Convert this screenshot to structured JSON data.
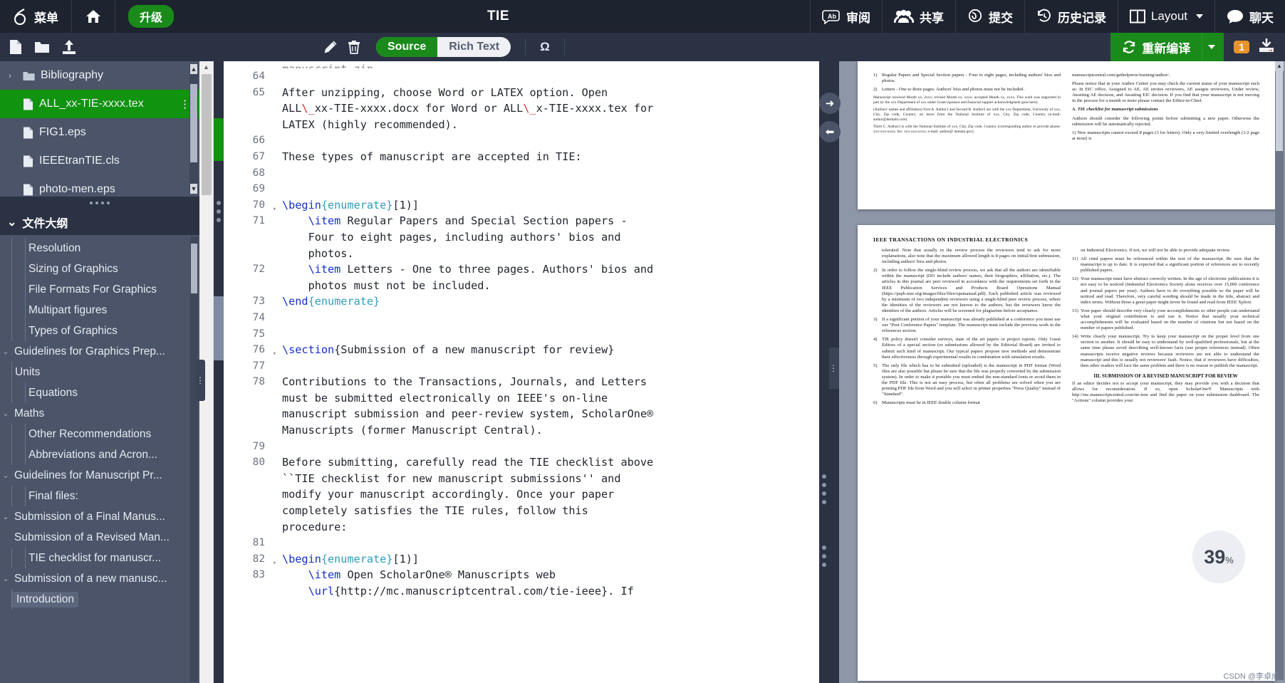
{
  "topbar": {
    "menu_label": "菜单",
    "home_icon": "home-icon",
    "upgrade_label": "升级",
    "project_title": "TIE",
    "review_label": "审阅",
    "share_label": "共享",
    "submit_label": "提交",
    "history_label": "历史记录",
    "layout_label": "Layout",
    "chat_label": "聊天"
  },
  "toolbar2": {
    "new_file_icon": "new-file-icon",
    "new_folder_icon": "new-folder-icon",
    "upload_icon": "upload-icon",
    "rename_icon": "pencil-icon",
    "delete_icon": "trash-icon",
    "source_label": "Source",
    "richtext_label": "Rich Text",
    "symbol_label": "Ω",
    "recompile_label": "重新编译",
    "warning_count": "1",
    "download_icon": "download-icon"
  },
  "sidebar": {
    "files": [
      {
        "label": "Bibliography",
        "type": "folder",
        "selected": false
      },
      {
        "label": "ALL_xx-TIE-xxxx.tex",
        "type": "file",
        "selected": true
      },
      {
        "label": "FIG1.eps",
        "type": "file",
        "selected": false
      },
      {
        "label": "IEEEtranTIE.cls",
        "type": "file",
        "selected": false
      },
      {
        "label": "photo-men.eps",
        "type": "file",
        "selected": false
      }
    ],
    "outline_header": "文件大纲",
    "outline": [
      {
        "label": "Introduction",
        "level": 1,
        "caret": "",
        "active": true
      },
      {
        "label": "Submission of a new manusc...",
        "level": 0,
        "caret": "v",
        "active": false
      },
      {
        "label": "TIE checklist for manuscr...",
        "level": 2,
        "caret": "",
        "active": false
      },
      {
        "label": "Submission of a Revised Man...",
        "level": 0,
        "caret": "",
        "active": false
      },
      {
        "label": "Submission of a Final Manus...",
        "level": 0,
        "caret": "v",
        "active": false
      },
      {
        "label": "Final files:",
        "level": 2,
        "caret": "",
        "active": false
      },
      {
        "label": "Guidelines for Manuscript Pr...",
        "level": 0,
        "caret": "v",
        "active": false
      },
      {
        "label": "Abbreviations and Acron...",
        "level": 2,
        "caret": "",
        "active": false
      },
      {
        "label": "Other Recommendations",
        "level": 2,
        "caret": "",
        "active": false
      },
      {
        "label": "Maths",
        "level": 0,
        "caret": "v",
        "active": false
      },
      {
        "label": "Equations",
        "level": 2,
        "caret": "",
        "active": false
      },
      {
        "label": "Units",
        "level": 1,
        "caret": "",
        "active": false
      },
      {
        "label": "Guidelines for Graphics Prep...",
        "level": 0,
        "caret": "v",
        "active": false
      },
      {
        "label": "Types of Graphics",
        "level": 2,
        "caret": "",
        "active": false
      },
      {
        "label": "Multipart figures",
        "level": 2,
        "caret": "",
        "active": false
      },
      {
        "label": "File Formats For Graphics",
        "level": 2,
        "caret": "",
        "active": false
      },
      {
        "label": "Sizing of Graphics",
        "level": 2,
        "caret": "",
        "active": false
      },
      {
        "label": "Resolution",
        "level": 2,
        "caret": "",
        "active": false
      }
    ]
  },
  "editor": {
    "top_partial_line": "manuscript.zip.",
    "lines": [
      {
        "n": "64",
        "fold": false,
        "segments": []
      },
      {
        "n": "65",
        "fold": false,
        "segments": [
          {
            "t": "After unzipping, choose Word or LATEX option. Open",
            "c": ""
          }
        ]
      },
      {
        "n": "",
        "fold": false,
        "segments": [
          {
            "t": "ALL",
            "c": ""
          },
          {
            "t": "\\_",
            "c": "bs"
          },
          {
            "t": "xx-TIE-xxxx.docx for Word or ALL",
            "c": ""
          },
          {
            "t": "\\_",
            "c": "bs"
          },
          {
            "t": "x-TIE-xxxx.tex for",
            "c": ""
          }
        ]
      },
      {
        "n": "",
        "fold": false,
        "segments": [
          {
            "t": "LATEX (highly recommended).",
            "c": ""
          }
        ]
      },
      {
        "n": "66",
        "fold": false,
        "segments": []
      },
      {
        "n": "67",
        "fold": false,
        "segments": [
          {
            "t": "These types of manuscript are accepted in TIE:",
            "c": ""
          }
        ]
      },
      {
        "n": "68",
        "fold": false,
        "segments": []
      },
      {
        "n": "69",
        "fold": false,
        "segments": []
      },
      {
        "n": "70",
        "fold": true,
        "segments": [
          {
            "t": "\\begin",
            "c": "kw"
          },
          {
            "t": "{enumerate}",
            "c": "env"
          },
          {
            "t": "[1)]",
            "c": ""
          }
        ]
      },
      {
        "n": "71",
        "fold": false,
        "segments": [
          {
            "t": "    ",
            "c": ""
          },
          {
            "t": "\\item",
            "c": "kw"
          },
          {
            "t": " Regular Papers and Special Section papers -",
            "c": ""
          }
        ]
      },
      {
        "n": "",
        "fold": false,
        "segments": [
          {
            "t": "    Four to eight pages, including authors' bios and",
            "c": ""
          }
        ]
      },
      {
        "n": "",
        "fold": false,
        "segments": [
          {
            "t": "    photos.",
            "c": ""
          }
        ]
      },
      {
        "n": "72",
        "fold": false,
        "segments": [
          {
            "t": "    ",
            "c": ""
          },
          {
            "t": "\\item",
            "c": "kw"
          },
          {
            "t": " Letters - One to three pages. Authors' bios and",
            "c": ""
          }
        ]
      },
      {
        "n": "",
        "fold": false,
        "segments": [
          {
            "t": "    photos must not be included.",
            "c": ""
          }
        ]
      },
      {
        "n": "73",
        "fold": false,
        "segments": [
          {
            "t": "\\end",
            "c": "kw"
          },
          {
            "t": "{enumerate}",
            "c": "env"
          }
        ]
      },
      {
        "n": "74",
        "fold": false,
        "segments": []
      },
      {
        "n": "75",
        "fold": false,
        "segments": []
      },
      {
        "n": "76",
        "fold": true,
        "segments": [
          {
            "t": "\\section",
            "c": "kw"
          },
          {
            "t": "{Submission of a new manuscript for review}",
            "c": ""
          }
        ]
      },
      {
        "n": "77",
        "fold": false,
        "segments": []
      },
      {
        "n": "78",
        "fold": false,
        "segments": [
          {
            "t": "Contributions to the Transactions, Journals, and Letters",
            "c": ""
          }
        ]
      },
      {
        "n": "",
        "fold": false,
        "segments": [
          {
            "t": "must be submitted electronically on IEEE's on-line",
            "c": ""
          }
        ]
      },
      {
        "n": "",
        "fold": false,
        "segments": [
          {
            "t": "manuscript submission and peer-review system, ScholarOne®",
            "c": ""
          }
        ]
      },
      {
        "n": "",
        "fold": false,
        "segments": [
          {
            "t": "Manuscripts (former Manuscript Central).",
            "c": ""
          }
        ]
      },
      {
        "n": "79",
        "fold": false,
        "segments": []
      },
      {
        "n": "80",
        "fold": false,
        "segments": [
          {
            "t": "Before submitting, carefully read the TIE checklist above",
            "c": ""
          }
        ]
      },
      {
        "n": "",
        "fold": false,
        "segments": [
          {
            "t": "``TIE checklist for new manuscript submissions'' and",
            "c": ""
          }
        ]
      },
      {
        "n": "",
        "fold": false,
        "segments": [
          {
            "t": "modify your manuscript accordingly. Once your paper",
            "c": ""
          }
        ]
      },
      {
        "n": "",
        "fold": false,
        "segments": [
          {
            "t": "completely satisfies the TIE rules, follow this",
            "c": ""
          }
        ]
      },
      {
        "n": "",
        "fold": false,
        "segments": [
          {
            "t": "procedure:",
            "c": ""
          }
        ]
      },
      {
        "n": "81",
        "fold": false,
        "segments": []
      },
      {
        "n": "82",
        "fold": true,
        "segments": [
          {
            "t": "\\begin",
            "c": "kw"
          },
          {
            "t": "{enumerate}",
            "c": "env"
          },
          {
            "t": "[1)]",
            "c": ""
          }
        ]
      },
      {
        "n": "83",
        "fold": false,
        "segments": [
          {
            "t": "    ",
            "c": ""
          },
          {
            "t": "\\item",
            "c": "kw"
          },
          {
            "t": " Open ScholarOne® Manuscripts web",
            "c": ""
          }
        ]
      },
      {
        "n": "",
        "fold": false,
        "segments": [
          {
            "t": "    ",
            "c": ""
          },
          {
            "t": "\\url",
            "c": "kw"
          },
          {
            "t": "{http://mc.manuscriptcentral.com/tie-ieee}",
            "c": ""
          },
          {
            "t": ". If",
            "c": ""
          }
        ]
      }
    ]
  },
  "pdf": {
    "zoom_level": "39",
    "zoom_unit": "%",
    "page1": {
      "col_left": [
        {
          "num": "1)",
          "text": "Regular Papers and Special Section papers - Four to eight pages, including authors' bios and photos."
        },
        {
          "num": "2)",
          "text": "Letters - One to three pages. Authors' bios and photos must not be included."
        }
      ],
      "meta_line": "Manuscript received Month xx, 2xxx; revised Month xx, xxxx; accepted Month xx, xxxx. This work was supported in part by the xxx Department of xxx under Grant (sponsor and financial support acknowledgment goes here).",
      "author_note_1": "(Authors' names and affiliation) First A. Author1 and Second B. Author2 are with the xxx Department, University of xxx, City, Zip code, Country, on leave from the National Institute of xxx, City, Zip code, Country (e-mail: author@domain.com).",
      "author_note_2": "Third C. Author3 is with the National Institute of xxx, City, Zip code, Country (corresponding author to provide phone: xxx-xxx-xxxx; fax: xxx-xxx-xxxx; e-mail: author@ domain.gov).",
      "col_right_top": "manuscriptcentral.com/gethelpnow/training/author/.",
      "col_right_p1": "Please notice that in your Author Center you may check the current status of your manuscript such as: In EIC office, Assigned to AE, AE invites reviewers, AE assigns reviewers, Under review, Awaiting AE decision, and Awaiting EIC decision. If you find that your manuscript is not moving in the process for a month or more please contact the Editor-in-Chief.",
      "checklist_title": "A. TIE checklist for manuscript submissions",
      "checklist_intro": "Authors should consider the following points before submitting a new paper. Otherwise the submission will be automatically rejected.",
      "checklist_item1": "1) New manuscripts cannot exceed 8 pages (3 for letters). Only a very limited overlength (1/2 page at most) is"
    },
    "page2": {
      "header": "IEEE TRANSACTIONS ON INDUSTRIAL ELECTRONICS",
      "left_items": [
        {
          "num": "",
          "text": "tolerated. Note that usually in the review process the reviewers tend to ask for more explanations, also note that the maximum allowed length is 8 pages on initial/first submission, including authors' bios and photos."
        },
        {
          "num": "2)",
          "text": "In order to follow the single-blind review process, we ask that all the authors are identifiable within the manuscript (DO include authors' names, their biographies, affiliation, etc.). The articles in this journal are peer reviewed in accordance with the requirements set forth in the IEEE Publication Services and Products Board Operations Manual (https://pspb.ieee.org/images/files/files/opsmanual.pdf). Each published article was reviewed by a minimum of two independent reviewers using a single-blind peer review process, where the identities of the reviewers are not known to the authors, but the reviewers know the identities of the authors. Articles will be screened for plagiarism before acceptance."
        },
        {
          "num": "3)",
          "text": "If a significant portion of your manuscript was already published at a conference you must use our \"Post Conference Papers\" template. The manuscript must include the previous work in the references section."
        },
        {
          "num": "4)",
          "text": "TIE policy doesn't consider surveys, state of the art papers or project reports. Only Guest Editors of a special section (or submissions allowed by the Editorial Board) are invited to submit such kind of manuscript. Our typical papers propose new methods and demonstrate their effectiveness through experimental results in combination with simulation results."
        },
        {
          "num": "5)",
          "text": "The only file which has to be submitted (uploaded) is the manuscript in PDF format (Word files are also possible but please be sure that the file was properly converted by the submission system). In order to make it portable you must embed the non-standard fonts or avoid them in the PDF file. This is not an easy process, but often all problems are solved when you are printing PDF file from Word and you will select in printer properties \"Press Quality\" instead of \"Standard\"."
        },
        {
          "num": "6)",
          "text": "Manuscripts must be in IEEE double column format"
        }
      ],
      "right_items": [
        {
          "num": "",
          "text": "on Industrial Electronics. If not, we will not be able to provide adequate review."
        },
        {
          "num": "11)",
          "text": "All cited papers must be referenced within the text of the manuscript. Be sure that the manuscript is up to date. It is expected that a significant portion of references are to recently published papers."
        },
        {
          "num": "12)",
          "text": "Your manuscript must have abstract correctly written. In the age of electronic publications it is not easy to be noticed (Industrial Electronics Society alone receives over 15,000 conference and journal papers per year). Authors have to do everything possible so the paper will be noticed and read. Therefore, very careful wording should be made in the title, abstract and index terms. Without those a great paper might never be found and read from IEEE Xplore."
        },
        {
          "num": "13)",
          "text": "Your paper should describe very clearly your accomplishments so other people can understand what your original contribution is and use it. Notice that usually your technical accomplishments will be evaluated based on the number of citations but not based on the number of papers published."
        },
        {
          "num": "14)",
          "text": "Write clearly your manuscript. Try to keep your manuscript on the proper level from one section to another. It should be easy to understand by well-qualified professionals, but at the same time please avoid describing well-known facts (use proper references instead). Often manuscripts receive negative reviews because reviewers are not able to understand the manuscript and this is usually not reviewers' fault. Notice, that if reviewers have difficulties, then other readers will face the same problem and there is no reason to publish the manuscript."
        }
      ],
      "section_title_1": "III.",
      "section_title_2": "SUBMISSION OF A REVISED MANUSCRIPT FOR REVIEW",
      "section_body": "If an editor decides not to accept your manuscript, they may provide you with a decision that allows for reconsideration. If so, open ScholarOne® Manuscripts with http://mc.manuscriptcentral.com/tie-ieee and find the paper on your submission dashboard. The \"Actions\" column provides your"
    }
  },
  "watermark": "CSDN @李卓成"
}
